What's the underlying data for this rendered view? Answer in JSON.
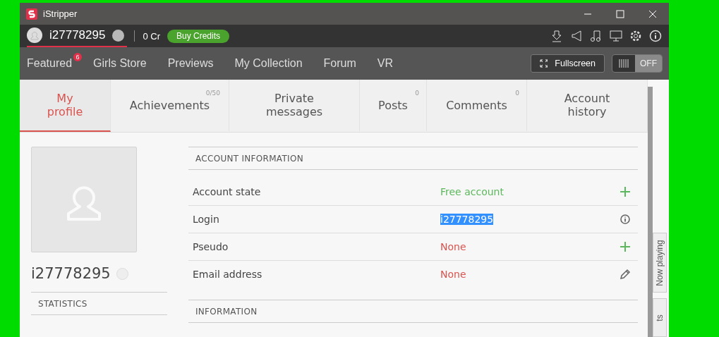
{
  "window": {
    "title": "iStripper"
  },
  "user_bar": {
    "username": "i27778295",
    "credits": "0 Cr",
    "buy_button": "Buy Credits"
  },
  "nav": {
    "items": [
      {
        "label": "Featured",
        "badge": "6"
      },
      {
        "label": "Girls Store"
      },
      {
        "label": "Previews"
      },
      {
        "label": "My Collection"
      },
      {
        "label": "Forum"
      },
      {
        "label": "VR"
      }
    ],
    "fullscreen_button": "Fullscreen",
    "toggle": {
      "label": "OFF",
      "on": false
    }
  },
  "tabs": [
    {
      "label": "My profile",
      "selected": true
    },
    {
      "label": "Achievements",
      "count": "0/50",
      "selected": false
    },
    {
      "label": "Private messages",
      "selected": false
    },
    {
      "label": "Posts",
      "count": "0",
      "selected": false
    },
    {
      "label": "Comments",
      "count": "0",
      "selected": false
    },
    {
      "label": "Account history",
      "selected": false
    }
  ],
  "profile": {
    "name": "i27778295",
    "statistics_heading": "STATISTICS"
  },
  "account_information": {
    "heading": "ACCOUNT INFORMATION",
    "rows": [
      {
        "label": "Account state",
        "value": "Free account",
        "color": "#5cb85c",
        "kind": "add",
        "selected": false
      },
      {
        "label": "Login",
        "value": "i27778295",
        "kind": "info",
        "selected": true
      },
      {
        "label": "Pseudo",
        "value": "None",
        "color": "#d9534f",
        "kind": "add",
        "selected": false
      },
      {
        "label": "Email address",
        "value": "None",
        "color": "#d9534f",
        "kind": "edit",
        "selected": false
      }
    ]
  },
  "information": {
    "heading": "INFORMATION"
  },
  "side_tabs": [
    {
      "label": "Now playing"
    },
    {
      "label": "ts"
    }
  ]
}
